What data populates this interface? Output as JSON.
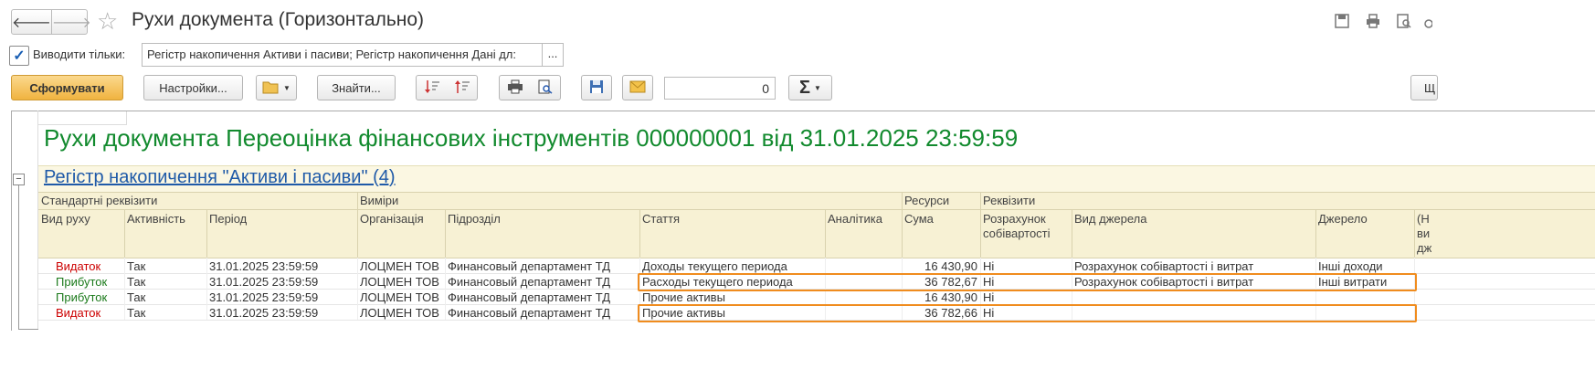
{
  "window": {
    "title": "Рухи документа (Горизонтально)",
    "nav_back": "🡐",
    "nav_forward": "🡒"
  },
  "filter": {
    "checked": true,
    "label": "Виводити тільки:",
    "value": "Регістр накопичення Активи і пасиви; Регістр накопичення Дані дл:",
    "more_button": "..."
  },
  "toolbar": {
    "generate": "Сформувати",
    "settings": "Настройки...",
    "find": "Знайти...",
    "sum_value": "0",
    "sigma": "Σ",
    "cut_button": "Щ"
  },
  "report": {
    "heading": "Рухи документа Переоцінка фінансових інструментів 000000001 від 31.01.2025 23:59:59",
    "register_link": "Регістр накопичення \"Активи і пасиви\" (4)",
    "collapse_symbol": "−",
    "groups": [
      "Стандартні реквізити",
      "Виміри",
      "Ресурси",
      "Реквізити"
    ],
    "columns": {
      "type": "Вид руху",
      "active": "Активність",
      "period": "Період",
      "org": "Організація",
      "dept": "Підрозділ",
      "article": "Стаття",
      "analytics": "Аналітика",
      "sum": "Сума",
      "cost_1": "Розрахунок",
      "cost_2": "собівартості",
      "source_type": "Вид джерела",
      "source": "Джерело",
      "extra_1": "(Н",
      "extra_2": "ви",
      "extra_3": "дж"
    },
    "rows": [
      {
        "type": "Видаток",
        "kind": "red",
        "active": "Так",
        "period": "31.01.2025 23:59:59",
        "org": "ЛОЦМЕН ТОВ",
        "dept": "Финансовый департамент ТД",
        "article": "Доходы текущего периода",
        "analytics": "",
        "sum": "16 430,90",
        "cost": "Ні",
        "source_type": "Розрахунок собівартості і витрат",
        "source": "Інші доходи"
      },
      {
        "type": "Прибуток",
        "kind": "green",
        "active": "Так",
        "period": "31.01.2025 23:59:59",
        "org": "ЛОЦМЕН ТОВ",
        "dept": "Финансовый департамент ТД",
        "article": "Расходы текущего периода",
        "analytics": "",
        "sum": "36 782,67",
        "cost": "Ні",
        "source_type": "Розрахунок собівартості і витрат",
        "source": "Інші витрати"
      },
      {
        "type": "Прибуток",
        "kind": "green",
        "active": "Так",
        "period": "31.01.2025 23:59:59",
        "org": "ЛОЦМЕН ТОВ",
        "dept": "Финансовый департамент ТД",
        "article": "Прочие активы",
        "analytics": "",
        "sum": "16 430,90",
        "cost": "Ні",
        "source_type": "",
        "source": ""
      },
      {
        "type": "Видаток",
        "kind": "red",
        "active": "Так",
        "period": "31.01.2025 23:59:59",
        "org": "ЛОЦМЕН ТОВ",
        "dept": "Финансовый департамент ТД",
        "article": "Прочие активы",
        "analytics": "",
        "sum": "36 782,66",
        "cost": "Ні",
        "source_type": "",
        "source": ""
      }
    ]
  },
  "colors": {
    "heading": "#128a2e",
    "link": "#1f5aa8",
    "highlight": "#f08c1e",
    "expense": "#cc0000",
    "income": "#1b7a1b"
  }
}
